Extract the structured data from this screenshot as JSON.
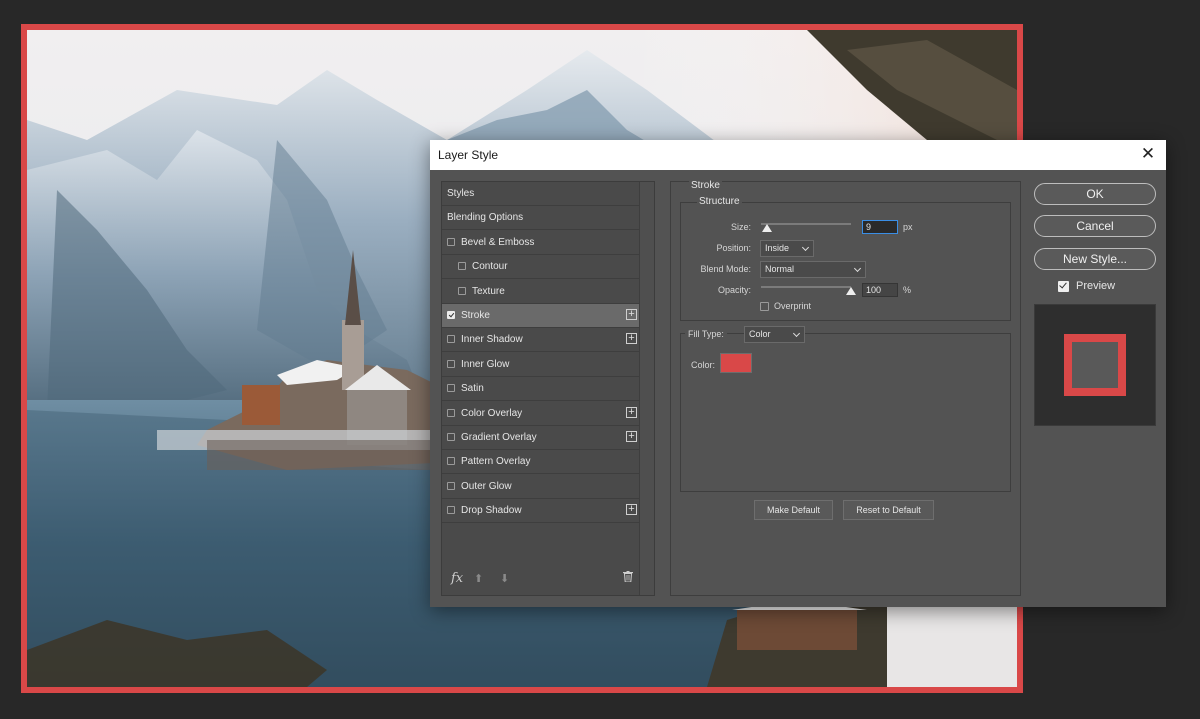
{
  "dialog": {
    "title": "Layer Style",
    "close_glyph": "✕",
    "styles_list": [
      {
        "label": "Styles",
        "checkbox": false,
        "checked": false,
        "plus": false,
        "selected": false,
        "indent": 0
      },
      {
        "label": "Blending Options",
        "checkbox": false,
        "checked": false,
        "plus": false,
        "selected": false,
        "indent": 0
      },
      {
        "label": "Bevel & Emboss",
        "checkbox": true,
        "checked": false,
        "plus": false,
        "selected": false,
        "indent": 0
      },
      {
        "label": "Contour",
        "checkbox": true,
        "checked": false,
        "plus": false,
        "selected": false,
        "indent": 1
      },
      {
        "label": "Texture",
        "checkbox": true,
        "checked": false,
        "plus": false,
        "selected": false,
        "indent": 1
      },
      {
        "label": "Stroke",
        "checkbox": true,
        "checked": true,
        "plus": true,
        "selected": true,
        "indent": 0
      },
      {
        "label": "Inner Shadow",
        "checkbox": true,
        "checked": false,
        "plus": true,
        "selected": false,
        "indent": 0
      },
      {
        "label": "Inner Glow",
        "checkbox": true,
        "checked": false,
        "plus": false,
        "selected": false,
        "indent": 0
      },
      {
        "label": "Satin",
        "checkbox": true,
        "checked": false,
        "plus": false,
        "selected": false,
        "indent": 0
      },
      {
        "label": "Color Overlay",
        "checkbox": true,
        "checked": false,
        "plus": true,
        "selected": false,
        "indent": 0
      },
      {
        "label": "Gradient Overlay",
        "checkbox": true,
        "checked": false,
        "plus": true,
        "selected": false,
        "indent": 0
      },
      {
        "label": "Pattern Overlay",
        "checkbox": true,
        "checked": false,
        "plus": false,
        "selected": false,
        "indent": 0
      },
      {
        "label": "Outer Glow",
        "checkbox": true,
        "checked": false,
        "plus": false,
        "selected": false,
        "indent": 0
      },
      {
        "label": "Drop Shadow",
        "checkbox": true,
        "checked": false,
        "plus": true,
        "selected": false,
        "indent": 0
      }
    ],
    "plus_glyph": "+",
    "bottom_toolbar": {
      "fx_label": "fx",
      "up_glyph": "⬆",
      "down_glyph": "⬇",
      "icons": [
        "fx-icon",
        "arrow-up-icon",
        "arrow-down-icon",
        "trash-icon"
      ]
    },
    "stroke": {
      "section_title": "Stroke",
      "structure_title": "Structure",
      "size_label": "Size:",
      "size_value": "9",
      "size_unit": "px",
      "size_slider_fraction": 0.03,
      "position_label": "Position:",
      "position_value": "Inside",
      "blend_mode_label": "Blend Mode:",
      "blend_mode_value": "Normal",
      "opacity_label": "Opacity:",
      "opacity_value": "100",
      "opacity_unit": "%",
      "opacity_slider_fraction": 1.0,
      "overprint_label": "Overprint",
      "overprint_checked": false,
      "fill_type_label": "Fill Type:",
      "fill_type_value": "Color",
      "color_label": "Color:",
      "color_value": "#d94848",
      "make_default_label": "Make Default",
      "reset_default_label": "Reset to Default"
    },
    "buttons": {
      "ok": "OK",
      "cancel": "Cancel",
      "new_style": "New Style..."
    },
    "preview": {
      "label": "Preview",
      "checked": true
    }
  },
  "colors": {
    "stroke_red": "#d94848",
    "dialog_bg": "#535353",
    "app_bg": "#282828"
  }
}
